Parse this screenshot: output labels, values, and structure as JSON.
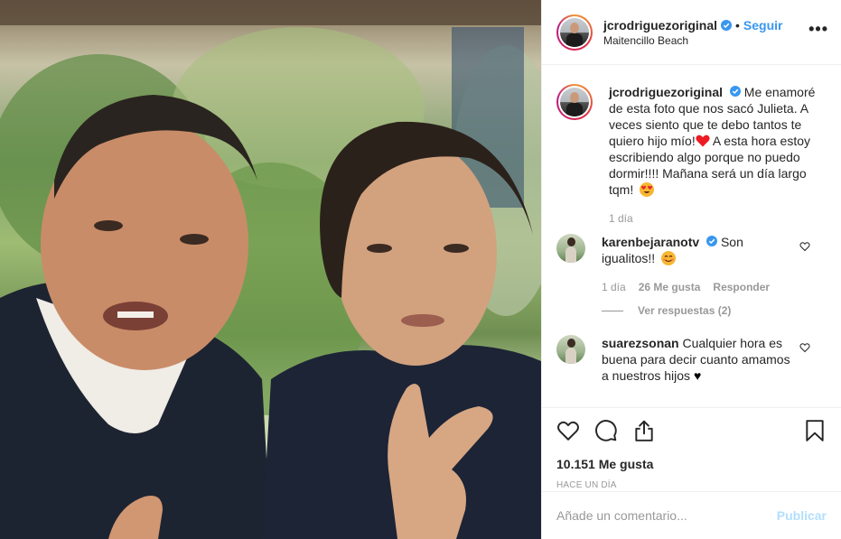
{
  "post": {
    "username": "jcrodriguezoriginal",
    "follow_label": "Seguir",
    "location": "Maitencillo Beach",
    "more_label": "•••",
    "image_alt": "Foto de padre e hijo"
  },
  "caption": {
    "username": "jcrodriguezoriginal",
    "text_part1": "Me enamoré de esta foto que nos sacó Julieta. A veces siento que te debo tantos te quiero hijo mío!",
    "text_part2": " A esta hora estoy escribiendo algo porque no puedo dormir!!!! Mañana será un día largo tqm!",
    "time": "1 día"
  },
  "comments": [
    {
      "username": "karenbejaranotv",
      "text": "Son igualitos!!",
      "time": "1 día",
      "likes": "26 Me gusta",
      "reply_label": "Responder",
      "view_replies": "Ver respuestas (2)"
    },
    {
      "username": "suarezsonan",
      "text": "Cualquier hora es buena para decir cuanto amamos a nuestros hijos",
      "heart": "♥"
    }
  ],
  "footer": {
    "likes": "10.151 Me gusta",
    "time_ago": "Hace un día",
    "comment_placeholder": "Añade un comentario...",
    "publish_label": "Publicar"
  },
  "icons": {
    "like": "heart-outline-icon",
    "comment": "speech-bubble-icon",
    "share": "share-icon",
    "save": "bookmark-icon",
    "verified": "verified-badge-icon"
  },
  "colors": {
    "link": "#3897f0",
    "verified": "#3897f0",
    "heart_emoji": "#ed1c24",
    "publish_disabled": "#b2dffc"
  }
}
